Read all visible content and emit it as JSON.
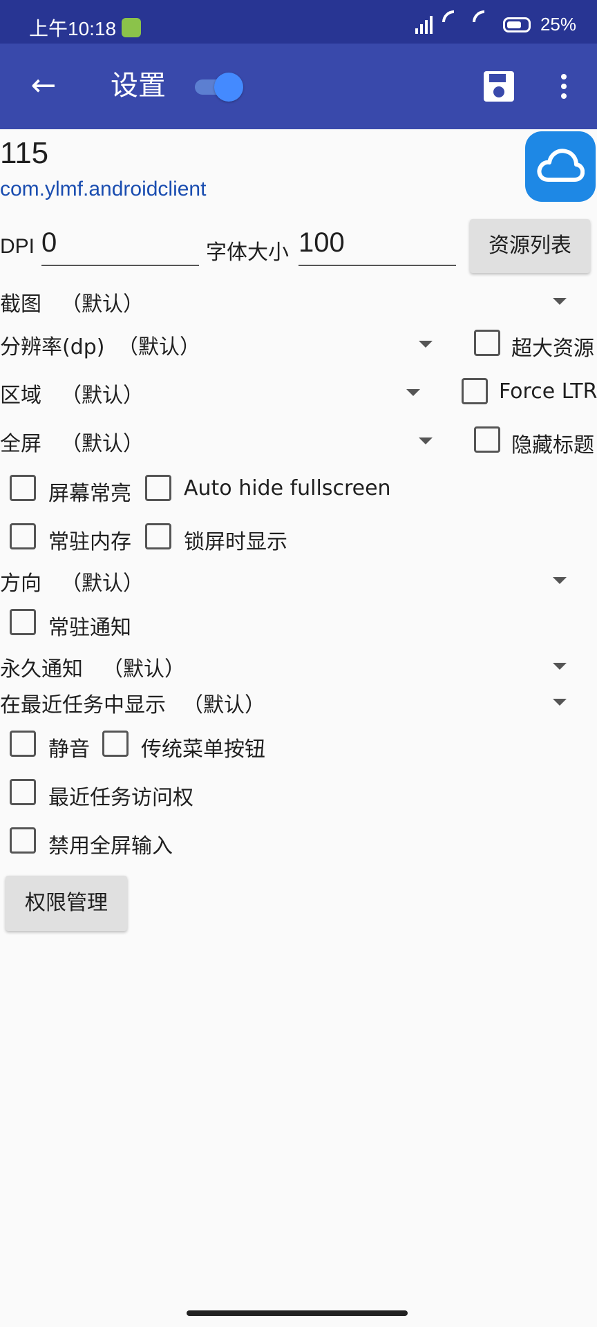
{
  "status_bar": {
    "time": "上午10:18",
    "battery": "25%"
  },
  "toolbar": {
    "title": "设置",
    "back_icon": "arrow-back-icon",
    "save_icon": "save-icon",
    "more_icon": "more-vert-icon",
    "toggle_on": true
  },
  "app": {
    "name": "115",
    "package": "com.ylmf.androidclient",
    "icon": "cloud-icon",
    "icon_color": "#1e88e5"
  },
  "dpi": {
    "label": "DPI",
    "value": "0"
  },
  "font_size": {
    "label": "字体大小",
    "value": "100"
  },
  "resource_list_button": "资源列表",
  "spinners": {
    "screenshot": {
      "label": "截图",
      "value": "（默认）"
    },
    "resolution": {
      "label": "分辨率(dp)",
      "value": "（默认）"
    },
    "region": {
      "label": "区域",
      "value": "（默认）"
    },
    "fullscreen": {
      "label": "全屏",
      "value": "（默认）"
    },
    "orientation": {
      "label": "方向",
      "value": "（默认）"
    },
    "permanent_notification": {
      "label": "永久通知",
      "value": "（默认）"
    },
    "show_in_recents": {
      "label": "在最近任务中显示",
      "value": "（默认）"
    }
  },
  "checkboxes": {
    "large_resources": "超大资源",
    "force_ltr": "Force LTR",
    "hide_title": "隐藏标题",
    "keep_screen_on": "屏幕常亮",
    "auto_hide_fullscreen": "Auto hide fullscreen",
    "resident_memory": "常驻内存",
    "show_on_lock_screen": "锁屏时显示",
    "persistent_notification": "常驻通知",
    "mute": "静音",
    "legacy_menu_button": "传统菜单按钮",
    "recents_access": "最近任务访问权",
    "disable_fullscreen_input": "禁用全屏输入"
  },
  "permissions_button": "权限管理",
  "colors": {
    "status_bar": "#283593",
    "toolbar": "#3949ab",
    "background": "#fafafa",
    "package_text": "#1a4db0"
  }
}
